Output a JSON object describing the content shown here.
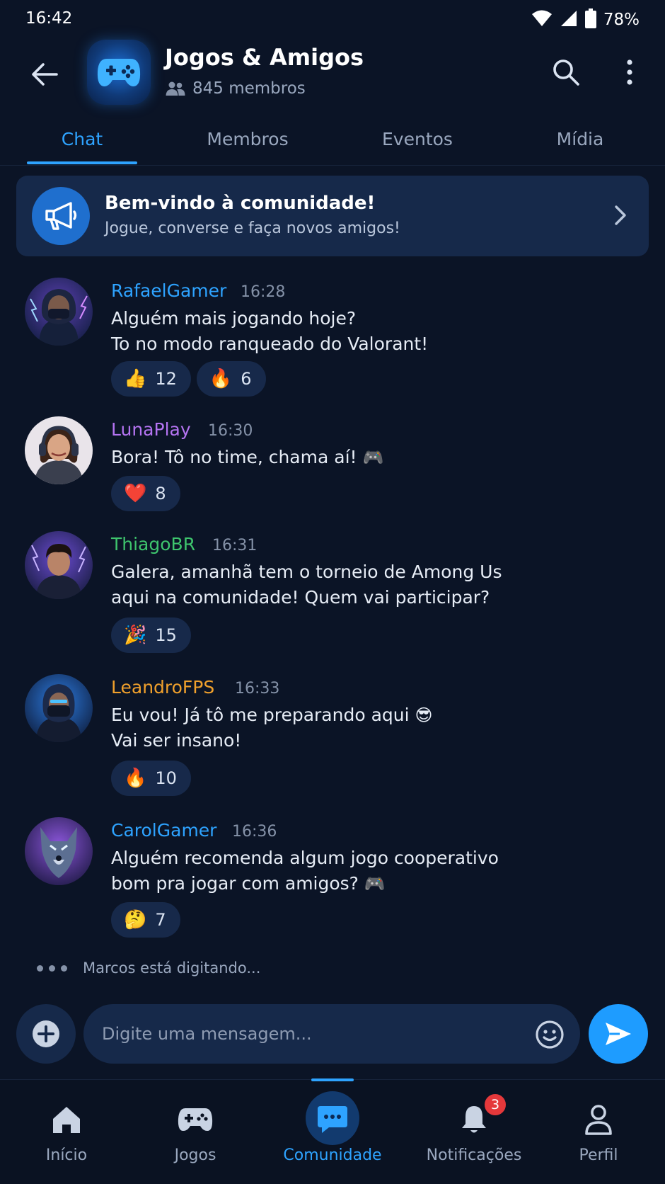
{
  "status_bar": {
    "time": "16:42",
    "battery": "78%"
  },
  "header": {
    "group_name": "Jogos & Amigos",
    "members": "845 membros",
    "icons": {
      "back": "arrow-left-icon",
      "search": "search-icon",
      "more": "more-vertical-icon",
      "group": "gamepad-icon"
    }
  },
  "tabs": [
    {
      "label": "Chat",
      "active": true
    },
    {
      "label": "Membros",
      "active": false
    },
    {
      "label": "Eventos",
      "active": false
    },
    {
      "label": "Mídia",
      "active": false
    }
  ],
  "banner": {
    "title": "Bem-vindo à comunidade!",
    "subtitle": "Jogue, converse e faça novos amigos!",
    "icon": "megaphone-icon"
  },
  "messages": [
    {
      "author": "RafaelGamer",
      "time": "16:28",
      "color": "#2ea3ff",
      "lines": [
        "Alguém mais jogando hoje?",
        "To no modo ranqueado do Valorant!"
      ],
      "reactions": [
        {
          "emoji": "👍",
          "count": "12"
        },
        {
          "emoji": "🔥",
          "count": "6"
        }
      ]
    },
    {
      "author": "LunaPlay",
      "time": "16:30",
      "color": "#b574f2",
      "lines": [
        "Bora! Tô no time, chama aí!"
      ],
      "inline_emoji": "🎮",
      "reactions": [
        {
          "emoji": "❤️",
          "count": "8"
        }
      ]
    },
    {
      "author": "ThiagoBR",
      "time": "16:31",
      "color": "#3ec46d",
      "lines": [
        "Galera, amanhã tem o torneio de Among Us",
        "aqui na comunidade! Quem vai participar?"
      ],
      "reactions": [
        {
          "emoji": "🎉",
          "count": "15"
        }
      ]
    },
    {
      "author": "LeandroFPS",
      "time": "16:33",
      "color": "#f0a02c",
      "lines": [
        "Eu vou! Já tô me preparando aqui",
        "Vai ser insano!"
      ],
      "inline_emoji": "😎",
      "reactions": [
        {
          "emoji": "🔥",
          "count": "10"
        }
      ]
    },
    {
      "author": "CarolGamer",
      "time": "16:36",
      "color": "#2ea3ff",
      "lines": [
        "Alguém recomenda algum jogo cooperativo",
        "bom pra jogar com amigos?"
      ],
      "inline_emoji": "🎮",
      "reactions": [
        {
          "emoji": "🤔",
          "count": "7"
        }
      ]
    }
  ],
  "typing": "Marcos está digitando...",
  "composer": {
    "placeholder": "Digite uma mensagem...",
    "icons": {
      "add": "plus-circle-icon",
      "emoji": "smiley-icon",
      "send": "send-icon"
    }
  },
  "bottom_nav": [
    {
      "label": "Início",
      "icon": "home-icon"
    },
    {
      "label": "Jogos",
      "icon": "gamepad-icon"
    },
    {
      "label": "Comunidade",
      "icon": "chat-bubble-icon",
      "active": true
    },
    {
      "label": "Notificações",
      "icon": "bell-icon",
      "badge": "3"
    },
    {
      "label": "Perfil",
      "icon": "user-icon"
    }
  ],
  "colors": {
    "background": "#0b1426",
    "accent": "#2ea3ff",
    "card": "#16294a",
    "badge": "#e5383b"
  }
}
